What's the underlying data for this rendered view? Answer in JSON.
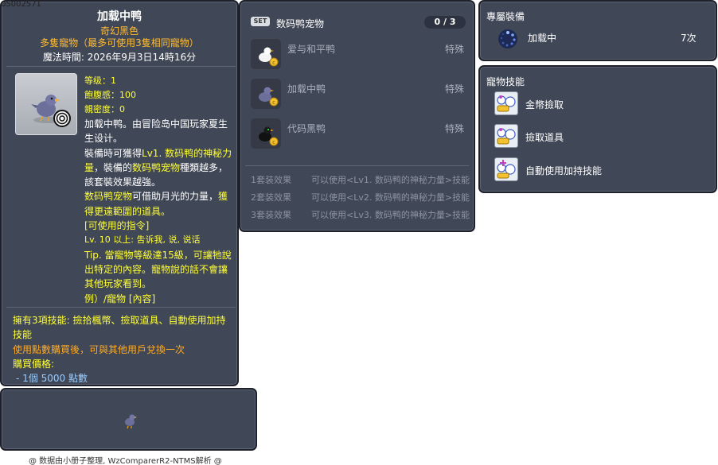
{
  "item_id": "05002571",
  "main": {
    "title": "加载中鸭",
    "subtitle1": "奇幻黑色",
    "subtitle2": "多隻寵物（最多可使用3隻相同寵物）",
    "expire": "魔法時間: 2026年9月3日14時16分",
    "stats": {
      "level": "等级：1",
      "fullness": "飽腹感：100",
      "closeness": "親密度：0"
    },
    "desc_p1": "加载中鸭。由冒险岛中国玩家夏生生设计。",
    "desc_p2_a": "裝備時可獲得",
    "desc_p2_b": "Lv1. 数码鸭的神秘力量",
    "desc_p2_c": "，裝備的",
    "desc_p2_d": "数码鸭宠物",
    "desc_p2_e": "種類越多，該套裝效果越強。",
    "desc_p3_a": "数码鸭宠物",
    "desc_p3_b": "可借助月光的力量，",
    "desc_p3_c": "獲得更遠範圍的道具。",
    "cmd_header": "[可使用的指令]",
    "cmd_text": "Lv. 10 以上: 吿诉我, 说, 说话",
    "tip": "Tip. 當寵物等級達15級，可讓牠說出特定的內容。寵物說的話不會讓其他玩家看到。",
    "example": "例）/寵物 [內容]",
    "skills_line": "擁有3項技能: 撿拾楓幣、撿取道具、自動使用加持技能",
    "exchange": "使用點數購買後，可與其他用戶兌換一次",
    "price_label": "購買價格:",
    "price_value": "- 1個 5000 點數"
  },
  "credit": "@ 数据由小册子整理, WzComparerR2-NTMS解析 @",
  "set": {
    "badge": "SET",
    "title": "数码鸭宠物",
    "count": "0 / 3",
    "items": [
      {
        "name": "爱与和平鸭",
        "type": "特殊"
      },
      {
        "name": "加载中鸭",
        "type": "特殊"
      },
      {
        "name": "代码黑鸭",
        "type": "特殊"
      }
    ],
    "effects": [
      {
        "label": "1套装效果",
        "text": "可以使用<Lv1. 数码鸭的神秘力量>技能"
      },
      {
        "label": "2套装效果",
        "text": "可以使用<Lv2. 数码鸭的神秘力量>技能"
      },
      {
        "label": "3套装效果",
        "text": "可以使用<Lv3. 数码鸭的神秘力量>技能"
      }
    ]
  },
  "equip": {
    "title": "專屬裝備",
    "name": "加载中",
    "count": "7次"
  },
  "skills": {
    "title": "寵物技能",
    "items": [
      {
        "name": "金幣撿取"
      },
      {
        "name": "撿取道具"
      },
      {
        "name": "自動使用加持技能"
      }
    ]
  }
}
